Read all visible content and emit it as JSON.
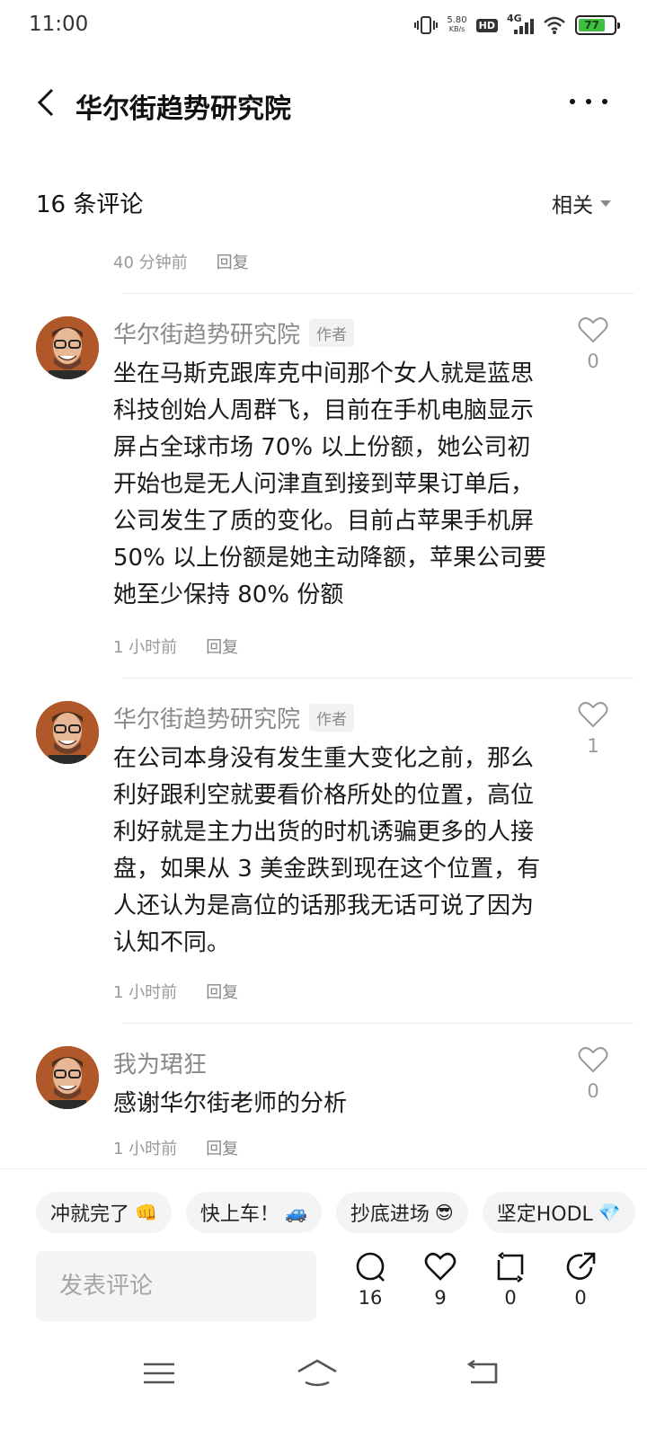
{
  "status_bar": {
    "time": "11:00",
    "net_speed_value": "5.80",
    "net_speed_unit": "KB/s",
    "hd_label": "HD",
    "network_label": "4G",
    "battery_level": "77"
  },
  "header": {
    "title": "华尔街趋势研究院"
  },
  "comments_section": {
    "count_label": "16 条评论",
    "sort_label": "相关",
    "previous_meta": {
      "time": "40 分钟前",
      "reply": "回复"
    }
  },
  "comments": [
    {
      "author": "华尔街趋势研究院",
      "tag": "作者",
      "text": "坐在马斯克跟库克中间那个女人就是蓝思科技创始人周群飞，目前在手机电脑显示屏占全球市场 70% 以上份额，她公司初开始也是无人问津直到接到苹果订单后，公司发生了质的变化。目前占苹果手机屏 50% 以上份额是她主动降额，苹果公司要她至少保持 80% 份额",
      "likes": "0",
      "time": "1 小时前",
      "reply": "回复"
    },
    {
      "author": "华尔街趋势研究院",
      "tag": "作者",
      "text": "在公司本身没有发生重大变化之前，那么利好跟利空就要看价格所处的位置，高位利好就是主力出货的时机诱骗更多的人接盘，如果从 3 美金跌到现在这个位置，有人还认为是高位的话那我无话可说了因为认知不同。",
      "likes": "1",
      "time": "1 小时前",
      "reply": "回复"
    },
    {
      "author": "我为珺狂",
      "tag": "",
      "text": "感谢华尔街老师的分析",
      "likes": "0",
      "time": "1 小时前",
      "reply": "回复"
    }
  ],
  "quick_replies": [
    {
      "label": "冲就完了",
      "icon": "👊"
    },
    {
      "label": "快上车！",
      "icon": "🚙"
    },
    {
      "label": "抄底进场",
      "icon": "😎"
    },
    {
      "label": "坚定HODL",
      "icon": "💎"
    }
  ],
  "bottom_bar": {
    "input_placeholder": "发表评论",
    "comment_count": "16",
    "like_count": "9",
    "repost_count": "0",
    "share_count": "0"
  },
  "colors": {
    "avatar_bg": "#b0582a",
    "battery_green": "#3fbf3f",
    "muted_text": "#999999"
  }
}
